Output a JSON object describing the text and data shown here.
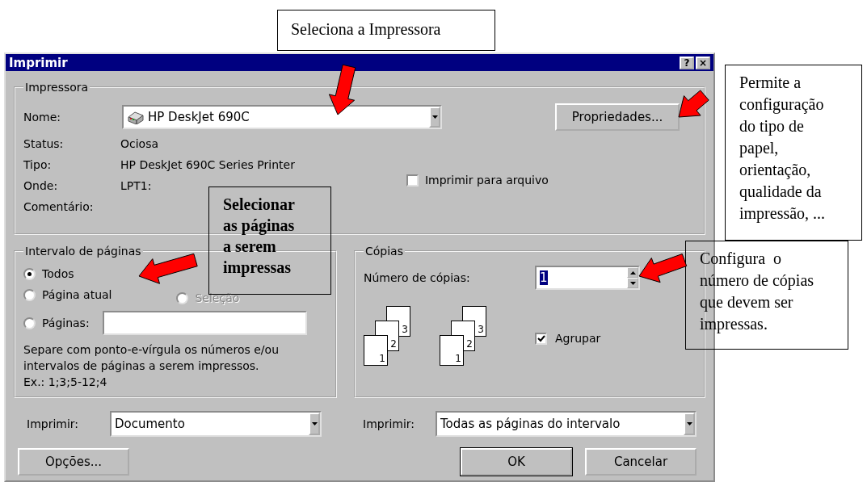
{
  "callouts": [
    {
      "text": "Seleciona a Impressora",
      "bold": false
    },
    {
      "text": "Permite a\nconfiguração\ndo tipo de\npapel,\norientação,\nqualidade da\nimpressão, ...",
      "bold": false
    },
    {
      "text": "Selecionar\nas páginas\na serem\nimpressas",
      "bold": true
    },
    {
      "text": "Configura  o\nnúmero de cópias\nque devem ser\nimpressas.",
      "bold": false
    }
  ],
  "dialog": {
    "title": "Imprimir",
    "title_buttons": [
      "?",
      "×"
    ],
    "printer": {
      "legend": "Impressora",
      "name_label": "Nome:",
      "name_value": "HP DeskJet 690C",
      "properties_button": "Propriedades...",
      "info": [
        {
          "label": "Status:",
          "value": "Ociosa"
        },
        {
          "label": "Tipo:",
          "value": "HP DeskJet 690C Series Printer"
        },
        {
          "label": "Onde:",
          "value": "LPT1:"
        },
        {
          "label": "Comentário:"
        }
      ],
      "print_to_file": {
        "label": "Imprimir para arquivo",
        "checked": false
      }
    },
    "range": {
      "legend": "Intervalo de páginas",
      "options": [
        {
          "label": "Todos",
          "selected": true,
          "disabled": false
        },
        {
          "label": "Página atual",
          "selected": false,
          "disabled": false
        },
        {
          "label": "Seleção",
          "selected": false,
          "disabled": true
        },
        {
          "label": "Páginas:",
          "selected": false,
          "disabled": false
        }
      ],
      "help": [
        "Separe com ponto-e-vírgula os números e/ou",
        "intervalos de páginas a serem impressos.",
        "Ex.: 1;3;5-12;4"
      ]
    },
    "copies": {
      "legend": "Cópias",
      "count_label": "Número de cópias:",
      "count_value": "1",
      "count_text_selected": true,
      "stacks": [
        [
          "1",
          "2",
          "3"
        ],
        [
          "1",
          "2",
          "3"
        ]
      ],
      "collate": {
        "label": "Agrupar",
        "checked": true
      }
    },
    "print_what": {
      "label": "Imprimir:",
      "value": "Documento"
    },
    "print_pages": {
      "label": "Imprimir:",
      "value": "Todas as páginas do intervalo"
    },
    "buttons": [
      {
        "label": "Opções...",
        "default": false
      },
      {
        "label": "OK",
        "default": true
      },
      {
        "label": "Cancelar",
        "default": false
      }
    ]
  }
}
